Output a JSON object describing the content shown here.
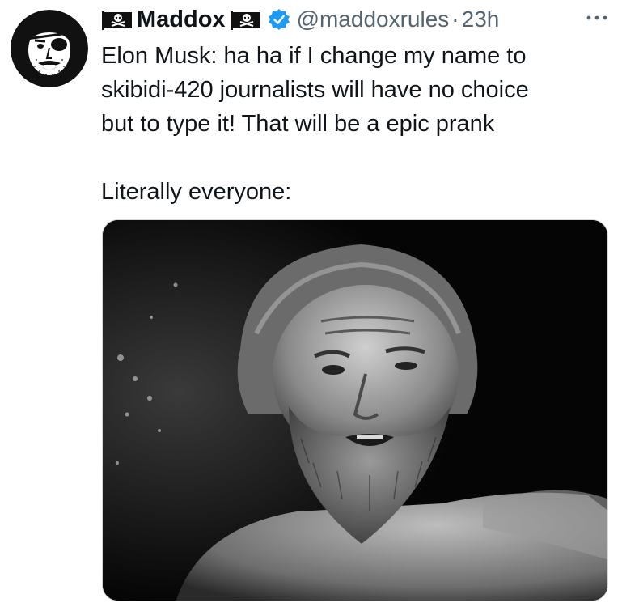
{
  "tweet": {
    "author": {
      "display_name": "Maddox",
      "handle": "@maddoxrules",
      "verified": true,
      "avatar_icon": "pirate-eyepatch-face",
      "name_decoration_icon": "pirate-flag-icon"
    },
    "separator": "·",
    "time": "23h",
    "more_icon": "more-horizontal-icon",
    "text_lines": [
      "Elon Musk: ha ha if I change my name to",
      "skibidi-420 journalists will have no choice",
      "but to type it! That will be a epic prank"
    ],
    "text_line_2": "Literally everyone:",
    "media": {
      "type": "image",
      "description_icon": "bearded-man-photo"
    }
  },
  "colors": {
    "text_primary": "#0f1419",
    "text_secondary": "#536471",
    "verified_blue": "#1d9bf0",
    "background": "#ffffff"
  }
}
